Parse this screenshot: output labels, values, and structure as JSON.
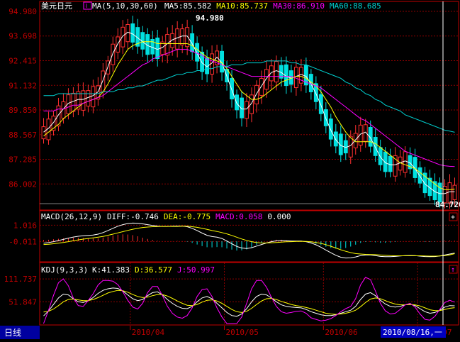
{
  "colors": {
    "background": "#000000",
    "frame": "#c00000",
    "grid": "#8b0000",
    "axis_text": "#c00000",
    "up": "#ff3030",
    "down": "#00e0e0",
    "white": "#ffffff",
    "yellow": "#ffff00",
    "magenta": "#ff00ff",
    "cyan": "#00d0d0",
    "date_box": "#0000c0",
    "footer_bg": "#0000a0"
  },
  "footer": {
    "period_label": "日线",
    "date_ticks": [
      "2010/04",
      "2010/05",
      "2010/06",
      "2010/07"
    ],
    "cursor_date": "2010/08/16,一"
  },
  "chart_data": [
    {
      "type": "candlestick",
      "title": "美元日元",
      "indicator_header": "MA(5,10,30,60)",
      "legend": [
        {
          "label": "MA5:85.582",
          "color": "#ffffff"
        },
        {
          "label": "MA10:85.737",
          "color": "#ffff00"
        },
        {
          "label": "MA30:86.910",
          "color": "#ff00ff"
        },
        {
          "label": "MA60:88.685",
          "color": "#00d0d0"
        }
      ],
      "y_ticks": [
        "94.980",
        "93.698",
        "92.415",
        "91.132",
        "89.850",
        "88.567",
        "87.285",
        "86.002"
      ],
      "y_tick_values": [
        94.98,
        93.698,
        92.415,
        91.132,
        89.85,
        88.567,
        87.285,
        86.002
      ],
      "ylim": [
        84.72,
        94.98
      ],
      "high_marker": "94.980",
      "low_marker": "84.720",
      "grid": true,
      "series": [
        {
          "name": "MA5",
          "values": [
            88.7,
            88.9,
            89.2,
            89.6,
            89.9,
            90.2,
            90.3,
            90.4,
            90.4,
            90.5,
            90.6,
            90.8,
            91.4,
            92.1,
            92.8,
            93.3,
            93.7,
            93.9,
            93.8,
            93.6,
            93.4,
            93.2,
            93.1,
            93.0,
            93.1,
            93.3,
            93.5,
            93.6,
            93.7,
            93.7,
            93.3,
            92.8,
            92.3,
            92.1,
            92.3,
            92.6,
            92.3,
            91.6,
            90.9,
            90.2,
            89.9,
            89.9,
            90.2,
            90.7,
            91.1,
            91.5,
            91.8,
            91.9,
            91.8,
            91.6,
            91.5,
            91.6,
            91.7,
            91.6,
            91.2,
            90.7,
            90.1,
            89.4,
            88.8,
            88.3,
            88.0,
            87.9,
            88.0,
            88.3,
            88.6,
            88.7,
            88.4,
            87.9,
            87.4,
            87.1,
            87.0,
            87.0,
            87.1,
            87.2,
            87.1,
            86.8,
            86.4,
            86.0,
            85.8,
            85.6,
            85.5,
            85.5,
            85.6,
            85.6
          ]
        },
        {
          "name": "MA10",
          "values": [
            88.5,
            88.7,
            88.9,
            89.1,
            89.4,
            89.6,
            89.8,
            90.0,
            90.2,
            90.3,
            90.4,
            90.5,
            90.8,
            91.2,
            91.7,
            92.2,
            92.6,
            93.0,
            93.2,
            93.3,
            93.4,
            93.4,
            93.4,
            93.3,
            93.3,
            93.3,
            93.3,
            93.3,
            93.3,
            93.3,
            93.2,
            93.0,
            92.8,
            92.6,
            92.5,
            92.4,
            92.3,
            92.0,
            91.6,
            91.2,
            90.8,
            90.6,
            90.4,
            90.4,
            90.5,
            90.7,
            90.9,
            91.1,
            91.3,
            91.4,
            91.5,
            91.6,
            91.6,
            91.5,
            91.3,
            91.1,
            90.8,
            90.4,
            90.0,
            89.5,
            89.1,
            88.7,
            88.4,
            88.2,
            88.2,
            88.2,
            88.2,
            88.1,
            87.9,
            87.7,
            87.5,
            87.3,
            87.1,
            87.0,
            86.9,
            86.8,
            86.6,
            86.4,
            86.2,
            86.0,
            85.8,
            85.7,
            85.7,
            85.74
          ]
        },
        {
          "name": "MA30",
          "values": [
            89.8,
            89.8,
            89.8,
            89.9,
            89.9,
            90.0,
            90.1,
            90.1,
            90.2,
            90.3,
            90.4,
            90.5,
            90.6,
            90.8,
            91.0,
            91.2,
            91.4,
            91.6,
            91.8,
            92.0,
            92.2,
            92.3,
            92.5,
            92.6,
            92.7,
            92.8,
            92.9,
            93.0,
            93.0,
            93.0,
            92.9,
            92.8,
            92.7,
            92.5,
            92.4,
            92.3,
            92.2,
            92.1,
            92.0,
            91.9,
            91.8,
            91.7,
            91.6,
            91.6,
            91.6,
            91.6,
            91.6,
            91.6,
            91.6,
            91.6,
            91.6,
            91.5,
            91.4,
            91.3,
            91.2,
            91.1,
            91.0,
            90.8,
            90.6,
            90.4,
            90.2,
            90.0,
            89.8,
            89.6,
            89.4,
            89.3,
            89.1,
            88.9,
            88.7,
            88.5,
            88.3,
            88.1,
            87.9,
            87.7,
            87.6,
            87.5,
            87.4,
            87.3,
            87.2,
            87.1,
            87.0,
            86.95,
            86.92,
            86.91
          ]
        },
        {
          "name": "MA60",
          "values": [
            90.6,
            90.6,
            90.6,
            90.7,
            90.7,
            90.7,
            90.7,
            90.7,
            90.7,
            90.7,
            90.7,
            90.7,
            90.8,
            90.8,
            90.8,
            90.9,
            90.9,
            91.0,
            91.0,
            91.1,
            91.1,
            91.2,
            91.3,
            91.4,
            91.4,
            91.5,
            91.6,
            91.7,
            91.7,
            91.8,
            91.8,
            91.9,
            91.9,
            92.0,
            92.0,
            92.1,
            92.1,
            92.1,
            92.2,
            92.2,
            92.2,
            92.3,
            92.3,
            92.3,
            92.3,
            92.4,
            92.4,
            92.4,
            92.4,
            92.4,
            92.3,
            92.3,
            92.2,
            92.2,
            92.1,
            92.0,
            91.9,
            91.8,
            91.7,
            91.6,
            91.5,
            91.3,
            91.2,
            91.0,
            90.9,
            90.7,
            90.6,
            90.4,
            90.3,
            90.1,
            90.0,
            89.9,
            89.8,
            89.6,
            89.5,
            89.4,
            89.3,
            89.2,
            89.1,
            89.0,
            88.9,
            88.8,
            88.75,
            88.69
          ]
        }
      ]
    },
    {
      "type": "line",
      "title": "MACD(26,12,9)",
      "legend": [
        {
          "label": "DIFF:-0.746",
          "color": "#ffffff"
        },
        {
          "label": "DEA:-0.775",
          "color": "#ffff00"
        },
        {
          "label": "MACD:0.058",
          "color": "#ff00ff"
        },
        {
          "label": "0.000",
          "color": "#ffffff"
        }
      ],
      "y_ticks": [
        "1.016",
        "-0.011"
      ],
      "y_tick_values": [
        1.016,
        -0.011
      ],
      "ylim": [
        -1.2,
        1.3
      ],
      "grid": true,
      "series": [
        {
          "name": "DIFF",
          "values": [
            -0.12,
            -0.08,
            -0.02,
            0.05,
            0.12,
            0.2,
            0.27,
            0.32,
            0.35,
            0.37,
            0.4,
            0.45,
            0.55,
            0.68,
            0.82,
            0.95,
            1.05,
            1.12,
            1.15,
            1.14,
            1.1,
            1.05,
            1.0,
            0.96,
            0.94,
            0.94,
            0.95,
            0.96,
            0.96,
            0.92,
            0.82,
            0.68,
            0.52,
            0.38,
            0.3,
            0.26,
            0.18,
            0.02,
            -0.15,
            -0.32,
            -0.42,
            -0.45,
            -0.4,
            -0.3,
            -0.2,
            -0.1,
            -0.02,
            0.03,
            0.05,
            0.04,
            0.02,
            0.02,
            0.02,
            -0.02,
            -0.1,
            -0.22,
            -0.37,
            -0.55,
            -0.72,
            -0.88,
            -1.0,
            -1.05,
            -1.04,
            -0.98,
            -0.9,
            -0.86,
            -0.86,
            -0.9,
            -0.95,
            -0.97,
            -0.97,
            -0.95,
            -0.92,
            -0.9,
            -0.89,
            -0.9,
            -0.93,
            -0.96,
            -0.97,
            -0.96,
            -0.92,
            -0.86,
            -0.8,
            -0.746
          ]
        },
        {
          "name": "DEA",
          "values": [
            -0.2,
            -0.18,
            -0.15,
            -0.11,
            -0.07,
            -0.02,
            0.04,
            0.09,
            0.14,
            0.18,
            0.22,
            0.26,
            0.31,
            0.38,
            0.45,
            0.53,
            0.61,
            0.69,
            0.76,
            0.82,
            0.87,
            0.9,
            0.92,
            0.93,
            0.94,
            0.94,
            0.94,
            0.94,
            0.95,
            0.95,
            0.92,
            0.88,
            0.82,
            0.75,
            0.68,
            0.62,
            0.55,
            0.47,
            0.37,
            0.26,
            0.15,
            0.06,
            -0.02,
            -0.08,
            -0.1,
            -0.1,
            -0.09,
            -0.07,
            -0.05,
            -0.03,
            -0.02,
            -0.01,
            -0.01,
            -0.01,
            -0.03,
            -0.07,
            -0.13,
            -0.21,
            -0.31,
            -0.42,
            -0.53,
            -0.63,
            -0.71,
            -0.77,
            -0.8,
            -0.82,
            -0.83,
            -0.84,
            -0.86,
            -0.88,
            -0.9,
            -0.91,
            -0.91,
            -0.91,
            -0.91,
            -0.91,
            -0.91,
            -0.92,
            -0.93,
            -0.93,
            -0.92,
            -0.9,
            -0.85,
            -0.775
          ]
        },
        {
          "name": "MACD",
          "values": [
            0.16,
            0.2,
            0.26,
            0.32,
            0.38,
            0.44,
            0.46,
            0.46,
            0.42,
            0.38,
            0.36,
            0.38,
            0.48,
            0.6,
            0.74,
            0.84,
            0.88,
            0.86,
            0.78,
            0.64,
            0.46,
            0.3,
            0.16,
            0.06,
            0.0,
            0.0,
            0.02,
            0.04,
            0.02,
            -0.06,
            -0.2,
            -0.4,
            -0.6,
            -0.74,
            -0.76,
            -0.72,
            -0.74,
            -0.9,
            -1.04,
            -1.16,
            -1.14,
            -1.02,
            -0.76,
            -0.44,
            -0.2,
            0.0,
            0.14,
            0.2,
            0.2,
            0.14,
            0.08,
            0.06,
            0.06,
            -0.02,
            -0.14,
            -0.3,
            -0.48,
            -0.68,
            -0.82,
            -0.92,
            -0.94,
            -0.84,
            -0.66,
            -0.42,
            -0.2,
            -0.08,
            -0.06,
            -0.12,
            -0.18,
            -0.18,
            -0.14,
            -0.08,
            -0.02,
            0.02,
            0.04,
            0.02,
            -0.04,
            -0.08,
            -0.08,
            -0.06,
            0.0,
            0.08,
            0.1,
            0.058
          ]
        }
      ]
    },
    {
      "type": "line",
      "title": "KDJ(9,3,3)",
      "legend": [
        {
          "label": "K:41.383",
          "color": "#ffffff"
        },
        {
          "label": "D:36.577",
          "color": "#ffff00"
        },
        {
          "label": "J:50.997",
          "color": "#ff00ff"
        }
      ],
      "y_ticks": [
        "111.737",
        "51.847"
      ],
      "y_tick_values": [
        111.737,
        51.847
      ],
      "ylim": [
        -5,
        125
      ],
      "grid": true,
      "series": [
        {
          "name": "K",
          "values": [
            15,
            28,
            45,
            62,
            72,
            70,
            60,
            52,
            50,
            55,
            63,
            74,
            82,
            86,
            88,
            87,
            80,
            70,
            60,
            55,
            58,
            68,
            76,
            78,
            70,
            58,
            48,
            40,
            35,
            34,
            40,
            52,
            62,
            66,
            60,
            48,
            36,
            24,
            16,
            14,
            20,
            34,
            52,
            66,
            72,
            70,
            62,
            52,
            44,
            40,
            38,
            37,
            36,
            32,
            26,
            22,
            18,
            16,
            16,
            18,
            22,
            26,
            30,
            40,
            58,
            72,
            76,
            68,
            56,
            46,
            40,
            38,
            40,
            44,
            46,
            42,
            34,
            26,
            22,
            24,
            30,
            38,
            42,
            41.383
          ]
        },
        {
          "name": "D",
          "values": [
            25,
            27,
            33,
            42,
            52,
            58,
            59,
            57,
            55,
            55,
            58,
            63,
            69,
            75,
            79,
            82,
            81,
            77,
            71,
            66,
            63,
            64,
            68,
            71,
            71,
            67,
            61,
            54,
            48,
            43,
            42,
            45,
            51,
            56,
            57,
            54,
            48,
            40,
            32,
            26,
            24,
            27,
            35,
            45,
            54,
            60,
            61,
            58,
            53,
            49,
            45,
            42,
            40,
            37,
            34,
            30,
            26,
            22,
            20,
            19,
            20,
            22,
            25,
            30,
            39,
            50,
            59,
            62,
            60,
            55,
            50,
            46,
            44,
            44,
            45,
            44,
            41,
            36,
            31,
            29,
            29,
            32,
            35,
            36.577
          ]
        },
        {
          "name": "J",
          "values": [
            -5,
            30,
            69,
            102,
            112,
            94,
            62,
            42,
            40,
            55,
            73,
            96,
            108,
            108,
            106,
            97,
            78,
            56,
            38,
            33,
            48,
            76,
            92,
            92,
            68,
            40,
            22,
            12,
            9,
            16,
            36,
            66,
            84,
            86,
            66,
            36,
            12,
            -5,
            -5,
            -5,
            12,
            48,
            86,
            108,
            108,
            90,
            64,
            40,
            26,
            22,
            24,
            27,
            28,
            22,
            10,
            6,
            2,
            4,
            8,
            16,
            26,
            34,
            40,
            60,
            96,
            116,
            110,
            80,
            48,
            28,
            20,
            22,
            32,
            44,
            48,
            38,
            20,
            6,
            4,
            14,
            32,
            50,
            56,
            50.997
          ]
        }
      ]
    }
  ]
}
